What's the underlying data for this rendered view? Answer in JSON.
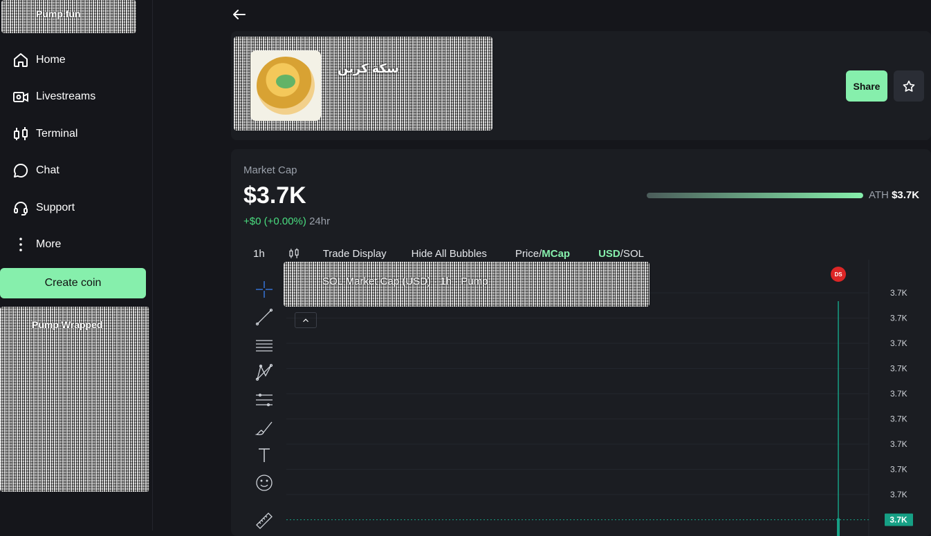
{
  "sidebar": {
    "logo_text": "Pump.fun",
    "items": [
      {
        "label": "Home",
        "icon": "home-icon"
      },
      {
        "label": "Livestreams",
        "icon": "video-icon"
      },
      {
        "label": "Terminal",
        "icon": "candlestick-icon"
      },
      {
        "label": "Chat",
        "icon": "chat-bubble-icon"
      },
      {
        "label": "Support",
        "icon": "headset-icon"
      },
      {
        "label": "More",
        "icon": "more-vertical-icon"
      }
    ],
    "create_label": "Create coin",
    "promo_title": "Pump Wrapped"
  },
  "token": {
    "name": "سكة كربن",
    "share_label": "Share"
  },
  "market": {
    "label": "Market Cap",
    "value": "$3.7K",
    "change": "+$0 (+0.00%)",
    "period": "24hr",
    "ath_label": "ATH",
    "ath_value": "$3.7K",
    "ath_progress": 1.0
  },
  "toolbar": {
    "interval": "1h",
    "trade_display": "Trade Display",
    "hide_bubbles": "Hide All Bubbles",
    "price_label": "Price/",
    "mcap_label": "MCap",
    "usd_label": "USD",
    "sol_label": "/SOL"
  },
  "chart_legend": "SOL Market Cap (USD) · 1h · Pump",
  "chart_data": {
    "type": "line",
    "yaxis_ticks": [
      "3.7K",
      "3.7K",
      "3.7K",
      "3.7K",
      "3.7K",
      "3.7K",
      "3.7K",
      "3.7K",
      "3.7K"
    ],
    "current_price_label": "3.7K",
    "marker_label": "DS",
    "series": [
      {
        "values": [
          3.7
        ]
      }
    ]
  },
  "colors": {
    "accent": "#86efac",
    "positive": "#4ade80",
    "price_line": "#16a085",
    "marker": "#dc2626"
  }
}
